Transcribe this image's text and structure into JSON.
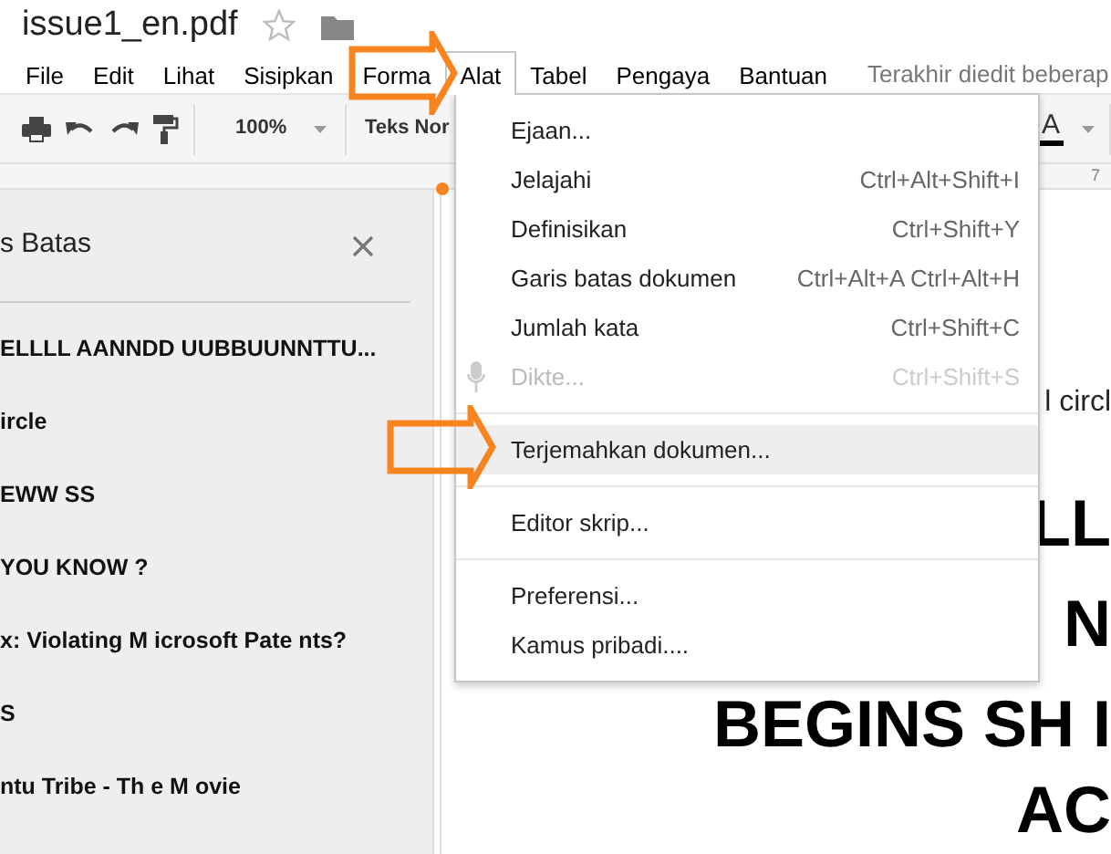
{
  "document": {
    "title": "issue1_en.pdf",
    "starred": false
  },
  "menubar": [
    {
      "label": "File",
      "selected": false
    },
    {
      "label": "Edit",
      "selected": false
    },
    {
      "label": "Lihat",
      "selected": false
    },
    {
      "label": "Sisipkan",
      "selected": false
    },
    {
      "label": "Forma",
      "selected": false
    },
    {
      "label": "Alat",
      "selected": true
    },
    {
      "label": "Tabel",
      "selected": false
    },
    {
      "label": "Pengaya",
      "selected": false
    },
    {
      "label": "Bantuan",
      "selected": false
    }
  ],
  "last_edit": "Terakhir diedit beberap",
  "toolbar": {
    "zoom": "100%",
    "style": "Teks Nor",
    "text_color": "A"
  },
  "ruler": {
    "mark": "7"
  },
  "outline_panel": {
    "title": "s Batas",
    "items": [
      "ELLLL AANNDD UUBBUUNNTTU...",
      "ircle",
      "EWW SS",
      "YOU KNOW ?",
      "x: Violating M icrosoft Pate nts?",
      "S",
      "ntu Tribe - Th e M ovie"
    ]
  },
  "menu": {
    "items": [
      {
        "kind": "item",
        "label": "Ejaan...",
        "disabled": false,
        "selected": false
      },
      {
        "kind": "item",
        "label": "Jelajahi",
        "shortcut": "Ctrl+Alt+Shift+I",
        "disabled": false,
        "selected": false
      },
      {
        "kind": "item",
        "label": "Definisikan",
        "shortcut": "Ctrl+Shift+Y",
        "disabled": false,
        "selected": false
      },
      {
        "kind": "item",
        "label": "Garis batas dokumen",
        "shortcut": "Ctrl+Alt+A Ctrl+Alt+H",
        "disabled": false,
        "selected": false
      },
      {
        "kind": "item",
        "label": "Jumlah kata",
        "shortcut": "Ctrl+Shift+C",
        "disabled": false,
        "selected": false
      },
      {
        "kind": "voice",
        "label": "Dikte...",
        "shortcut": "Ctrl+Shift+S",
        "disabled": true,
        "selected": false
      },
      {
        "kind": "divider"
      },
      {
        "kind": "item",
        "label": "Terjemahkan dokumen...",
        "disabled": false,
        "selected": true
      },
      {
        "kind": "divider"
      },
      {
        "kind": "item",
        "label": "Editor skrip...",
        "disabled": false,
        "selected": false
      },
      {
        "kind": "divider"
      },
      {
        "kind": "item",
        "label": "Preferensi...",
        "disabled": false,
        "selected": false
      },
      {
        "kind": "item",
        "label": "Kamus pribadi....",
        "disabled": false,
        "selected": false
      }
    ]
  },
  "document_text": [
    {
      "kind": "body",
      "text": "l circl"
    },
    {
      "kind": "heading",
      "text": "LL"
    },
    {
      "kind": "heading",
      "text": "N"
    },
    {
      "kind": "heading",
      "text": "BEGINS SH I"
    },
    {
      "kind": "heading",
      "text": "AC"
    }
  ]
}
